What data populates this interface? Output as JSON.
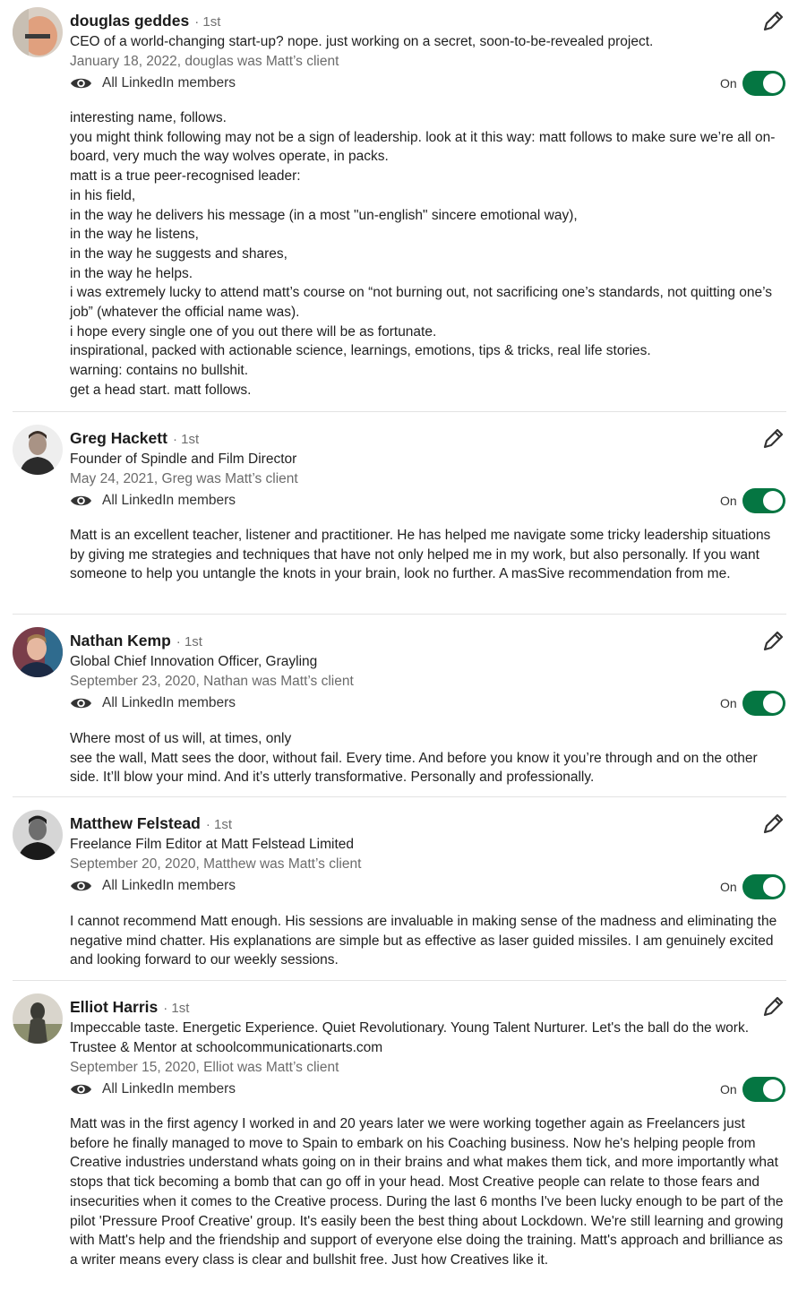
{
  "visibility_label": "All LinkedIn members",
  "toggle_label": "On",
  "recommendations": [
    {
      "name": "douglas geddes",
      "degree": "1st",
      "headline": "CEO of a world-changing start-up? nope. just working on a secret, soon-to-be-revealed project.",
      "date": "January 18, 2022, douglas was Matt’s client",
      "text": "interesting name, follows.\nyou might think following may not be a sign of leadership. look at it this way: matt follows to make sure we’re all on-board, very much the way wolves operate, in packs.\nmatt is a true peer-recognised leader:\n in his field,\nin the way he delivers his message (in a most \"un-english\" sincere emotional way),\nin the way he listens,\nin the way he suggests and shares,\nin the way he helps.\ni was extremely lucky to attend matt’s course on “not burning out, not sacrificing one’s standards, not quitting one’s job” (whatever the official name was).\ni hope every single one of you out there will be as fortunate.\n inspirational, packed with actionable science, learnings, emotions, tips & tricks, real life stories.\nwarning: contains no bullshit.\nget a head start. matt follows."
    },
    {
      "name": "Greg Hackett",
      "degree": "1st",
      "headline": "Founder of Spindle and Film Director",
      "date": "May 24, 2021, Greg was Matt’s client",
      "text": "Matt is an excellent teacher, listener and practitioner. He has helped me navigate some tricky leadership situations by giving me strategies and techniques that have not only helped me in my work, but also personally. If you want someone to help you untangle the knots in your brain, look no further. A masSive recommendation from me."
    },
    {
      "name": "Nathan Kemp",
      "degree": "1st",
      "headline": "Global Chief Innovation Officer, Grayling",
      "date": "September 23, 2020, Nathan was Matt’s client",
      "text": "Where most of us will, at times, only\nsee the wall, Matt sees the door, without fail. Every time. And before you know it you’re through and on the other side. It’ll blow your mind. And it’s utterly transformative. Personally and professionally."
    },
    {
      "name": "Matthew Felstead",
      "degree": "1st",
      "headline": "Freelance Film Editor at Matt Felstead Limited",
      "date": "September 20, 2020, Matthew was Matt’s client",
      "text": "I cannot recommend Matt enough. His sessions are invaluable in making sense of the madness and eliminating the negative mind chatter. His explanations are simple but as effective as laser guided missiles. I am genuinely excited and looking forward to our weekly sessions."
    },
    {
      "name": "Elliot Harris",
      "degree": "1st",
      "headline": "Impeccable taste. Energetic Experience. Quiet Revolutionary. Young Talent Nurturer. Let's the ball do the work. Trustee & Mentor at schoolcommunicationarts.com",
      "date": "September 15, 2020, Elliot was Matt’s client",
      "text": "Matt was in the first agency I worked in and 20 years later we were working together again as Freelancers just before he finally managed to move to Spain to embark on his Coaching business. Now he's helping people from Creative industries understand whats going on in their brains and what makes them tick, and more importantly what stops that tick becoming a bomb that can go off in your head. Most Creative people can relate to those fears and insecurities when it comes to the Creative process. During the last 6 months I've been lucky enough to be part of the pilot 'Pressure Proof Creative' group. It's easily been the best thing about Lockdown. We're still learning and growing with Matt's help and the friendship and support of everyone else doing the training. Matt's approach and brilliance as a writer means every class is clear and bullshit free. Just how Creatives like it."
    }
  ]
}
